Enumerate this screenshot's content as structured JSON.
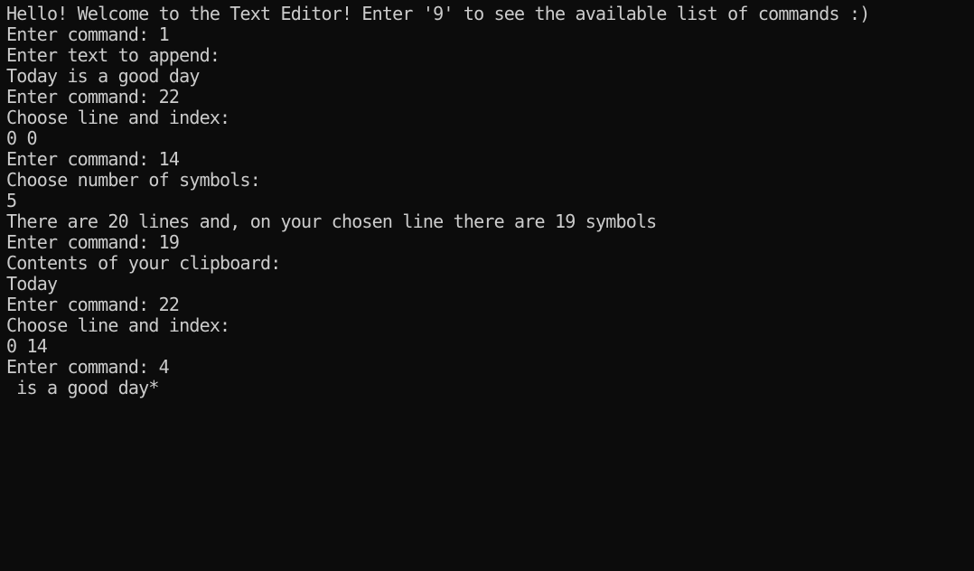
{
  "terminal": {
    "lines": [
      "Hello! Welcome to the Text Editor! Enter '9' to see the available list of commands :)",
      "Enter command: 1",
      "Enter text to append:",
      "Today is a good day",
      "Enter command: 22",
      "Choose line and index:",
      "0 0",
      "Enter command: 14",
      "Choose number of symbols:",
      "5",
      "There are 20 lines and, on your chosen line there are 19 symbols",
      "Enter command: 19",
      "Contents of your clipboard:",
      "Today",
      "Enter command: 22",
      "Choose line and index:",
      "0 14",
      "Enter command: 4",
      " is a good day*"
    ]
  },
  "colors": {
    "background": "#0c0c0c",
    "text": "#cccccc"
  }
}
